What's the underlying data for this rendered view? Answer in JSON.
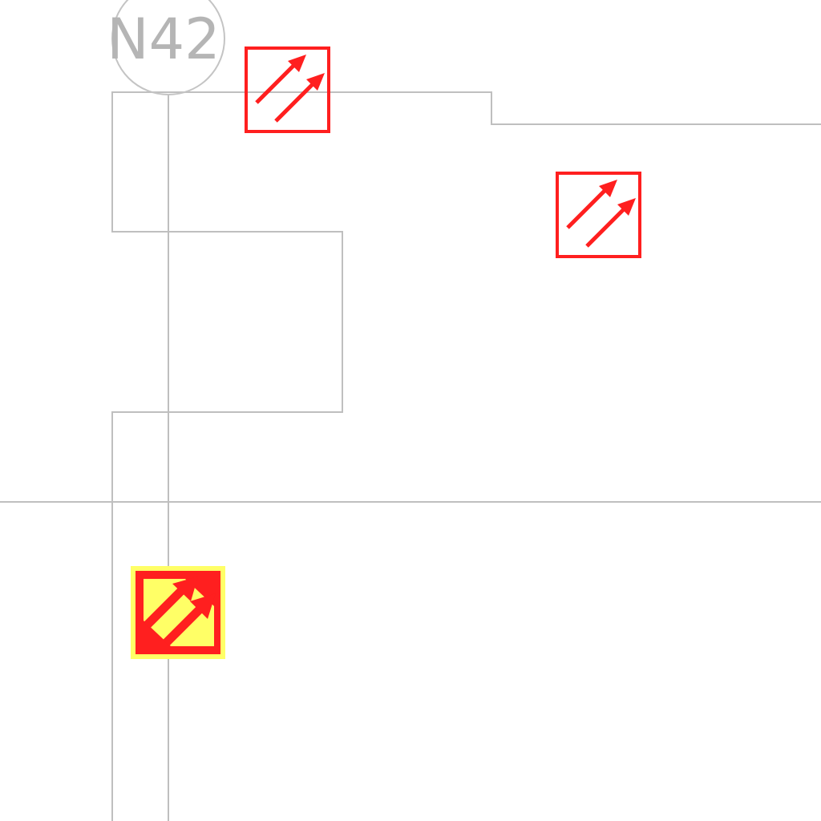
{
  "grid_label": {
    "text": "N42"
  },
  "colors": {
    "background": "#ffffff",
    "line": "#bfbfbf",
    "label": "#b5b5b5",
    "symbol": "#ff1f1f",
    "highlight": "#ffff66"
  },
  "symbols": [
    {
      "icon": "double-arrow-icon",
      "selected": false
    },
    {
      "icon": "double-arrow-icon",
      "selected": false
    },
    {
      "icon": "double-arrow-icon",
      "selected": true
    }
  ]
}
